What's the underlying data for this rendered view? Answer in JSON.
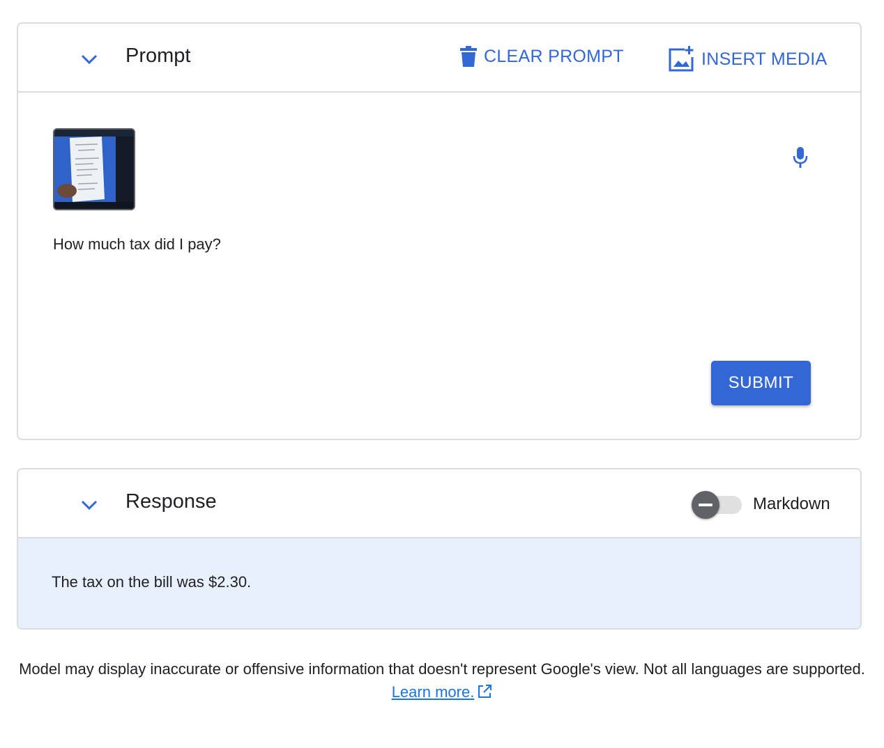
{
  "prompt": {
    "title": "Prompt",
    "clear_label": "CLEAR PROMPT",
    "insert_label": "INSERT MEDIA",
    "text": "How much tax did I pay?",
    "submit_label": "SUBMIT"
  },
  "response": {
    "title": "Response",
    "toggle_label": "Markdown",
    "toggle_on": false,
    "text": "The tax on the bill was $2.30."
  },
  "footer": {
    "disclaimer": "Model may display inaccurate or offensive information that doesn't represent Google's view. Not all languages are supported.",
    "learn_more": "Learn more."
  },
  "colors": {
    "accent": "#3367d6",
    "border": "#dadce0",
    "response_bg": "#e9f0fd"
  }
}
